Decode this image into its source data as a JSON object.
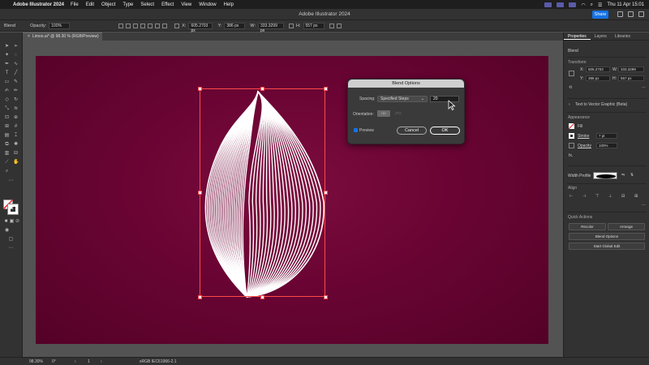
{
  "menubar": {
    "app_name": "Adobe Illustrator 2024",
    "menus": [
      "File",
      "Edit",
      "Object",
      "Type",
      "Select",
      "Effect",
      "View",
      "Window",
      "Help"
    ],
    "clock": "Thu 11 Apr  15:01"
  },
  "titlebar": {
    "title": "Adobe Illustrator 2024",
    "share_label": "Share"
  },
  "controlbar": {
    "selection_label": "Blend",
    "opacity_label": "Opacity:",
    "opacity_value": "100%",
    "x_label": "X:",
    "x_value": "605.2703 px",
    "y_label": "Y:",
    "y_value": "386 px",
    "w_label": "W:",
    "w_value": "333.3299 px",
    "h_label": "H:",
    "h_value": "557 px"
  },
  "document": {
    "tab_label": "Limoo.ai* @ 98.30 % (RGB/Preview)"
  },
  "dialog": {
    "title": "Blend Options",
    "spacing_label": "Spacing:",
    "spacing_value": "Specified Steps",
    "steps_value": "20",
    "orientation_label": "Orientation:",
    "preview_label": "Preview",
    "cancel_label": "Cancel",
    "ok_label": "OK"
  },
  "panel": {
    "tabs": [
      "Properties",
      "Layers",
      "Libraries"
    ],
    "object_type": "Blend",
    "transform_heading": "Transform",
    "x_value": "605.2703",
    "y_value": "386 px",
    "w_value": "333.3299",
    "h_value": "557 px",
    "text_to_vector": "Text to Vector Graphic (Beta)",
    "appearance_heading": "Appearance",
    "fill_label": "Fill",
    "stroke_label": "Stroke",
    "stroke_value": "7 pt",
    "opacity_label": "Opacity",
    "opacity_value": "100%",
    "fx_label": "fx.",
    "width_profile_label": "Width Profile",
    "align_heading": "Align",
    "quick_actions_heading": "Quick Actions",
    "recolor_label": "Recolor",
    "arrange_label": "Arrange",
    "blend_options_label": "Blend Options",
    "start_global_edit_label": "Start Global Edit"
  },
  "statusbar": {
    "zoom": "98.30%",
    "rotation": "0°",
    "artboard": "1",
    "color_profile": "sRGB IEC61966-2.1"
  },
  "colors": {
    "artboard": "#6a0433",
    "selection": "#ff4a4a",
    "accent": "#1473e6"
  }
}
